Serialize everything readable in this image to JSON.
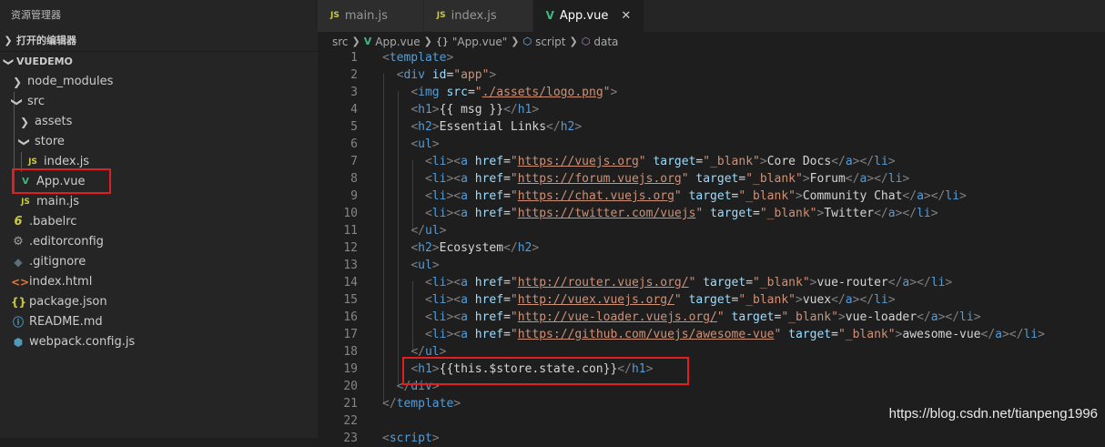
{
  "sidebar": {
    "title": "资源管理器",
    "open_editors_label": "打开的编辑器",
    "project_label": "VUEDEMO",
    "items": [
      {
        "label": "node_modules",
        "icon": "chevron-right-icon",
        "indent": 0
      },
      {
        "label": "src",
        "icon": "chevron-down-icon",
        "indent": 0
      },
      {
        "label": "assets",
        "icon": "chevron-right-icon",
        "indent": 1
      },
      {
        "label": "store",
        "icon": "chevron-down-icon",
        "indent": 1
      },
      {
        "label": "index.js",
        "icon": "js-icon",
        "indent": 2
      },
      {
        "label": "App.vue",
        "icon": "vue-icon",
        "indent": 1
      },
      {
        "label": "main.js",
        "icon": "js-icon",
        "indent": 1
      },
      {
        "label": ".babelrc",
        "icon": "babel-icon",
        "indent": 0
      },
      {
        "label": ".editorconfig",
        "icon": "gear-icon",
        "indent": 0
      },
      {
        "label": ".gitignore",
        "icon": "git-icon",
        "indent": 0
      },
      {
        "label": "index.html",
        "icon": "html-icon",
        "indent": 0
      },
      {
        "label": "package.json",
        "icon": "json-icon",
        "indent": 0
      },
      {
        "label": "README.md",
        "icon": "info-icon",
        "indent": 0
      },
      {
        "label": "webpack.config.js",
        "icon": "webpack-icon",
        "indent": 0
      }
    ]
  },
  "tabs": [
    {
      "label": "main.js",
      "icon": "JS",
      "active": false
    },
    {
      "label": "index.js",
      "icon": "JS",
      "active": false
    },
    {
      "label": "App.vue",
      "icon": "V",
      "active": true
    }
  ],
  "breadcrumb": {
    "src": "src",
    "file": "App.vue",
    "component": "\"App.vue\"",
    "script": "script",
    "data": "data"
  },
  "editor": {
    "line_numbers": [
      "1",
      "2",
      "3",
      "4",
      "5",
      "6",
      "7",
      "8",
      "9",
      "10",
      "11",
      "12",
      "13",
      "14",
      "15",
      "16",
      "17",
      "18",
      "19",
      "20",
      "21",
      "22",
      "23"
    ]
  },
  "watermark": "https://blog.csdn.net/tianpeng1996",
  "colors": {
    "highlight": "#e02020",
    "tag": "#569cd6",
    "attr": "#9cdcfe",
    "string": "#ce9178"
  }
}
